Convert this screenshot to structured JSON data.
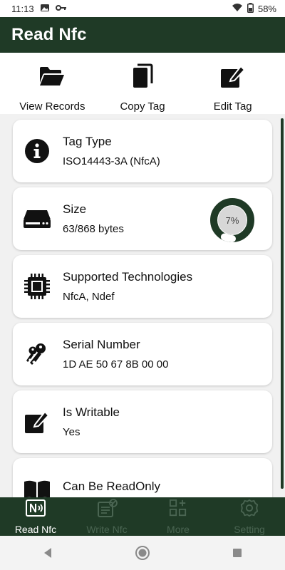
{
  "status_bar": {
    "time": "11:13",
    "battery": "58%",
    "icons": [
      "image-icon",
      "key-icon",
      "wifi-icon",
      "battery-icon"
    ]
  },
  "app_bar": {
    "title": "Read Nfc"
  },
  "actions": [
    {
      "label": "View Records",
      "icon": "folder-open-icon"
    },
    {
      "label": "Copy Tag",
      "icon": "copy-icon"
    },
    {
      "label": "Edit Tag",
      "icon": "edit-icon"
    }
  ],
  "cards": [
    {
      "title": "Tag Type",
      "value": "ISO14443-3A (NfcA)",
      "icon": "info-icon"
    },
    {
      "title": "Size",
      "value": "63/868 bytes",
      "icon": "hard-drive-icon",
      "progress_label": "7%",
      "progress_fraction": 0.07
    },
    {
      "title": "Supported Technologies",
      "value": "NfcA, Ndef",
      "icon": "chip-icon"
    },
    {
      "title": "Serial Number",
      "value": "1D AE 50 67 8B 00 00",
      "icon": "keys-icon"
    },
    {
      "title": "Is Writable",
      "value": "Yes",
      "icon": "edit-square-icon"
    },
    {
      "title": "Can Be ReadOnly",
      "value": "",
      "icon": "book-icon"
    }
  ],
  "bottom_nav": [
    {
      "label": "Read Nfc",
      "icon": "nfc-card-icon",
      "active": true
    },
    {
      "label": "Write Nfc",
      "icon": "write-nfc-icon",
      "active": false
    },
    {
      "label": "More",
      "icon": "grid-plus-icon",
      "active": false
    },
    {
      "label": "Setting",
      "icon": "settings-icon",
      "active": false
    }
  ],
  "colors": {
    "primary": "#1f3a26",
    "inactive_nav": "#4a6552",
    "list_bg": "#f1f1f1"
  }
}
